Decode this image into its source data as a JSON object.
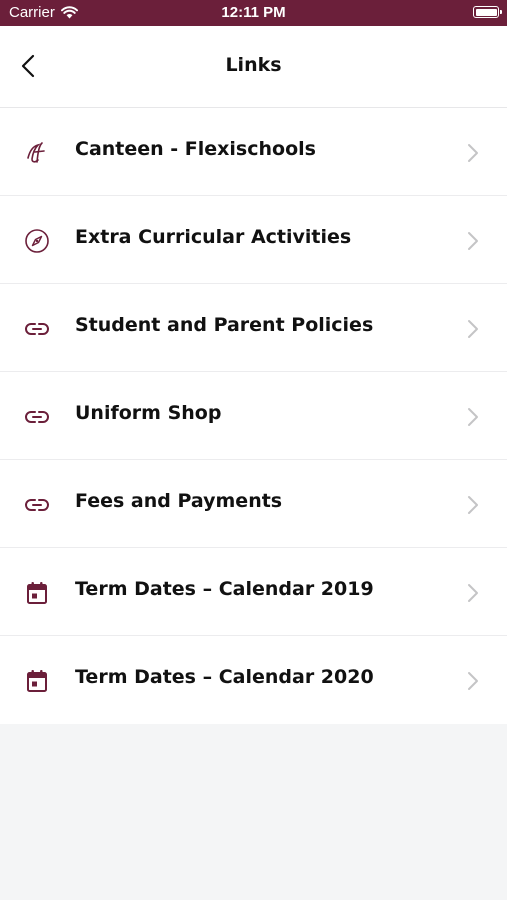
{
  "status_bar": {
    "carrier": "Carrier",
    "time": "12:11 PM"
  },
  "nav": {
    "title": "Links",
    "back_icon": "chevron-left-icon"
  },
  "colors": {
    "brand": "#6b1f3a",
    "chevron": "#c4c4c6"
  },
  "links": [
    {
      "label": "Canteen - Flexischools",
      "icon": "flexischools-logo-icon"
    },
    {
      "label": "Extra Curricular Activities",
      "icon": "compass-icon"
    },
    {
      "label": "Student and Parent Policies",
      "icon": "link-icon"
    },
    {
      "label": "Uniform Shop",
      "icon": "link-icon"
    },
    {
      "label": "Fees and Payments",
      "icon": "link-icon"
    },
    {
      "label": "Term Dates – Calendar 2019",
      "icon": "calendar-icon"
    },
    {
      "label": "Term Dates – Calendar 2020",
      "icon": "calendar-icon"
    }
  ]
}
